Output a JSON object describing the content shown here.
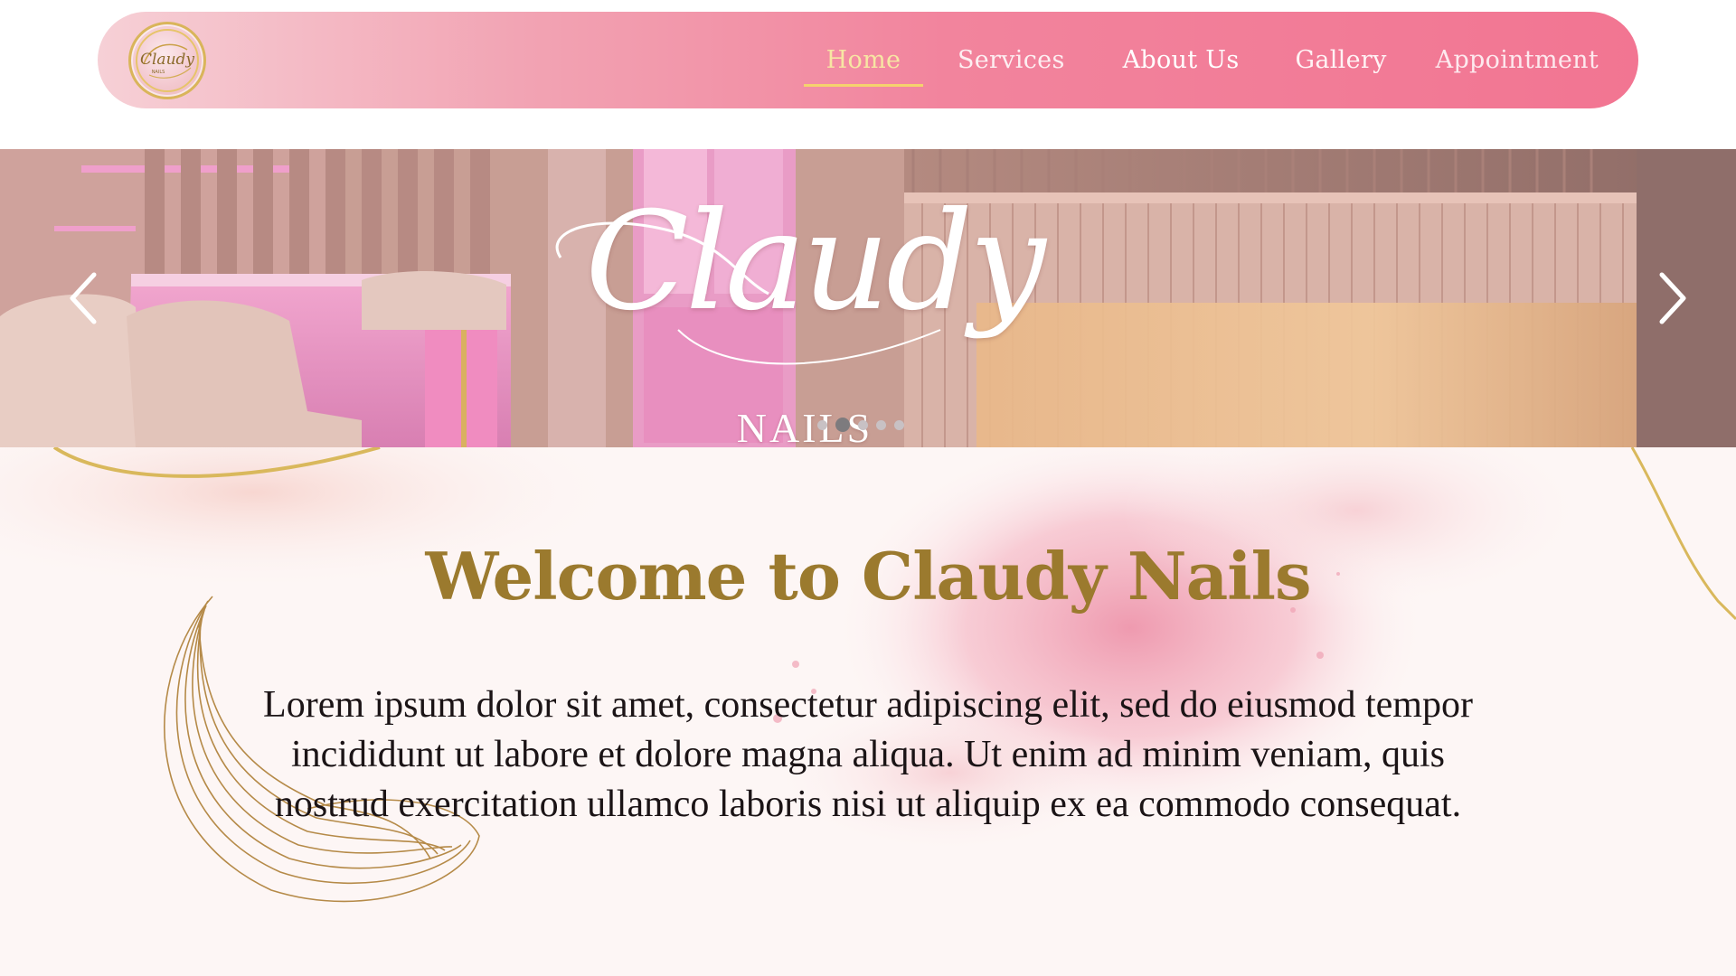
{
  "brand": {
    "logo_text": "Claudy",
    "logo_sub": "NAILS",
    "colors": {
      "nav_start": "#f6d0d6",
      "nav_end": "#f27592",
      "active_nav": "#f7e6a3",
      "gold": "#9b7a2e",
      "body_text": "#1b1416"
    }
  },
  "nav": {
    "items": [
      {
        "label": "Home",
        "active": true
      },
      {
        "label": "Services"
      },
      {
        "label": "About Us"
      },
      {
        "label": "Gallery"
      },
      {
        "label": "Appointment"
      }
    ]
  },
  "hero": {
    "script_title": "Claudy",
    "subtitle": "NAILS",
    "prev_icon": "chevron-left-icon",
    "next_icon": "chevron-right-icon",
    "slides_total": 5,
    "active_slide": 2
  },
  "welcome": {
    "title": "Welcome to Claudy Nails",
    "body": "Lorem ipsum dolor sit amet, consectetur adipiscing elit, sed do eiusmod tempor incididunt ut labore et dolore magna aliqua. Ut enim ad minim veniam, quis nostrud exercitation ullamco laboris nisi ut aliquip ex ea commodo consequat."
  }
}
